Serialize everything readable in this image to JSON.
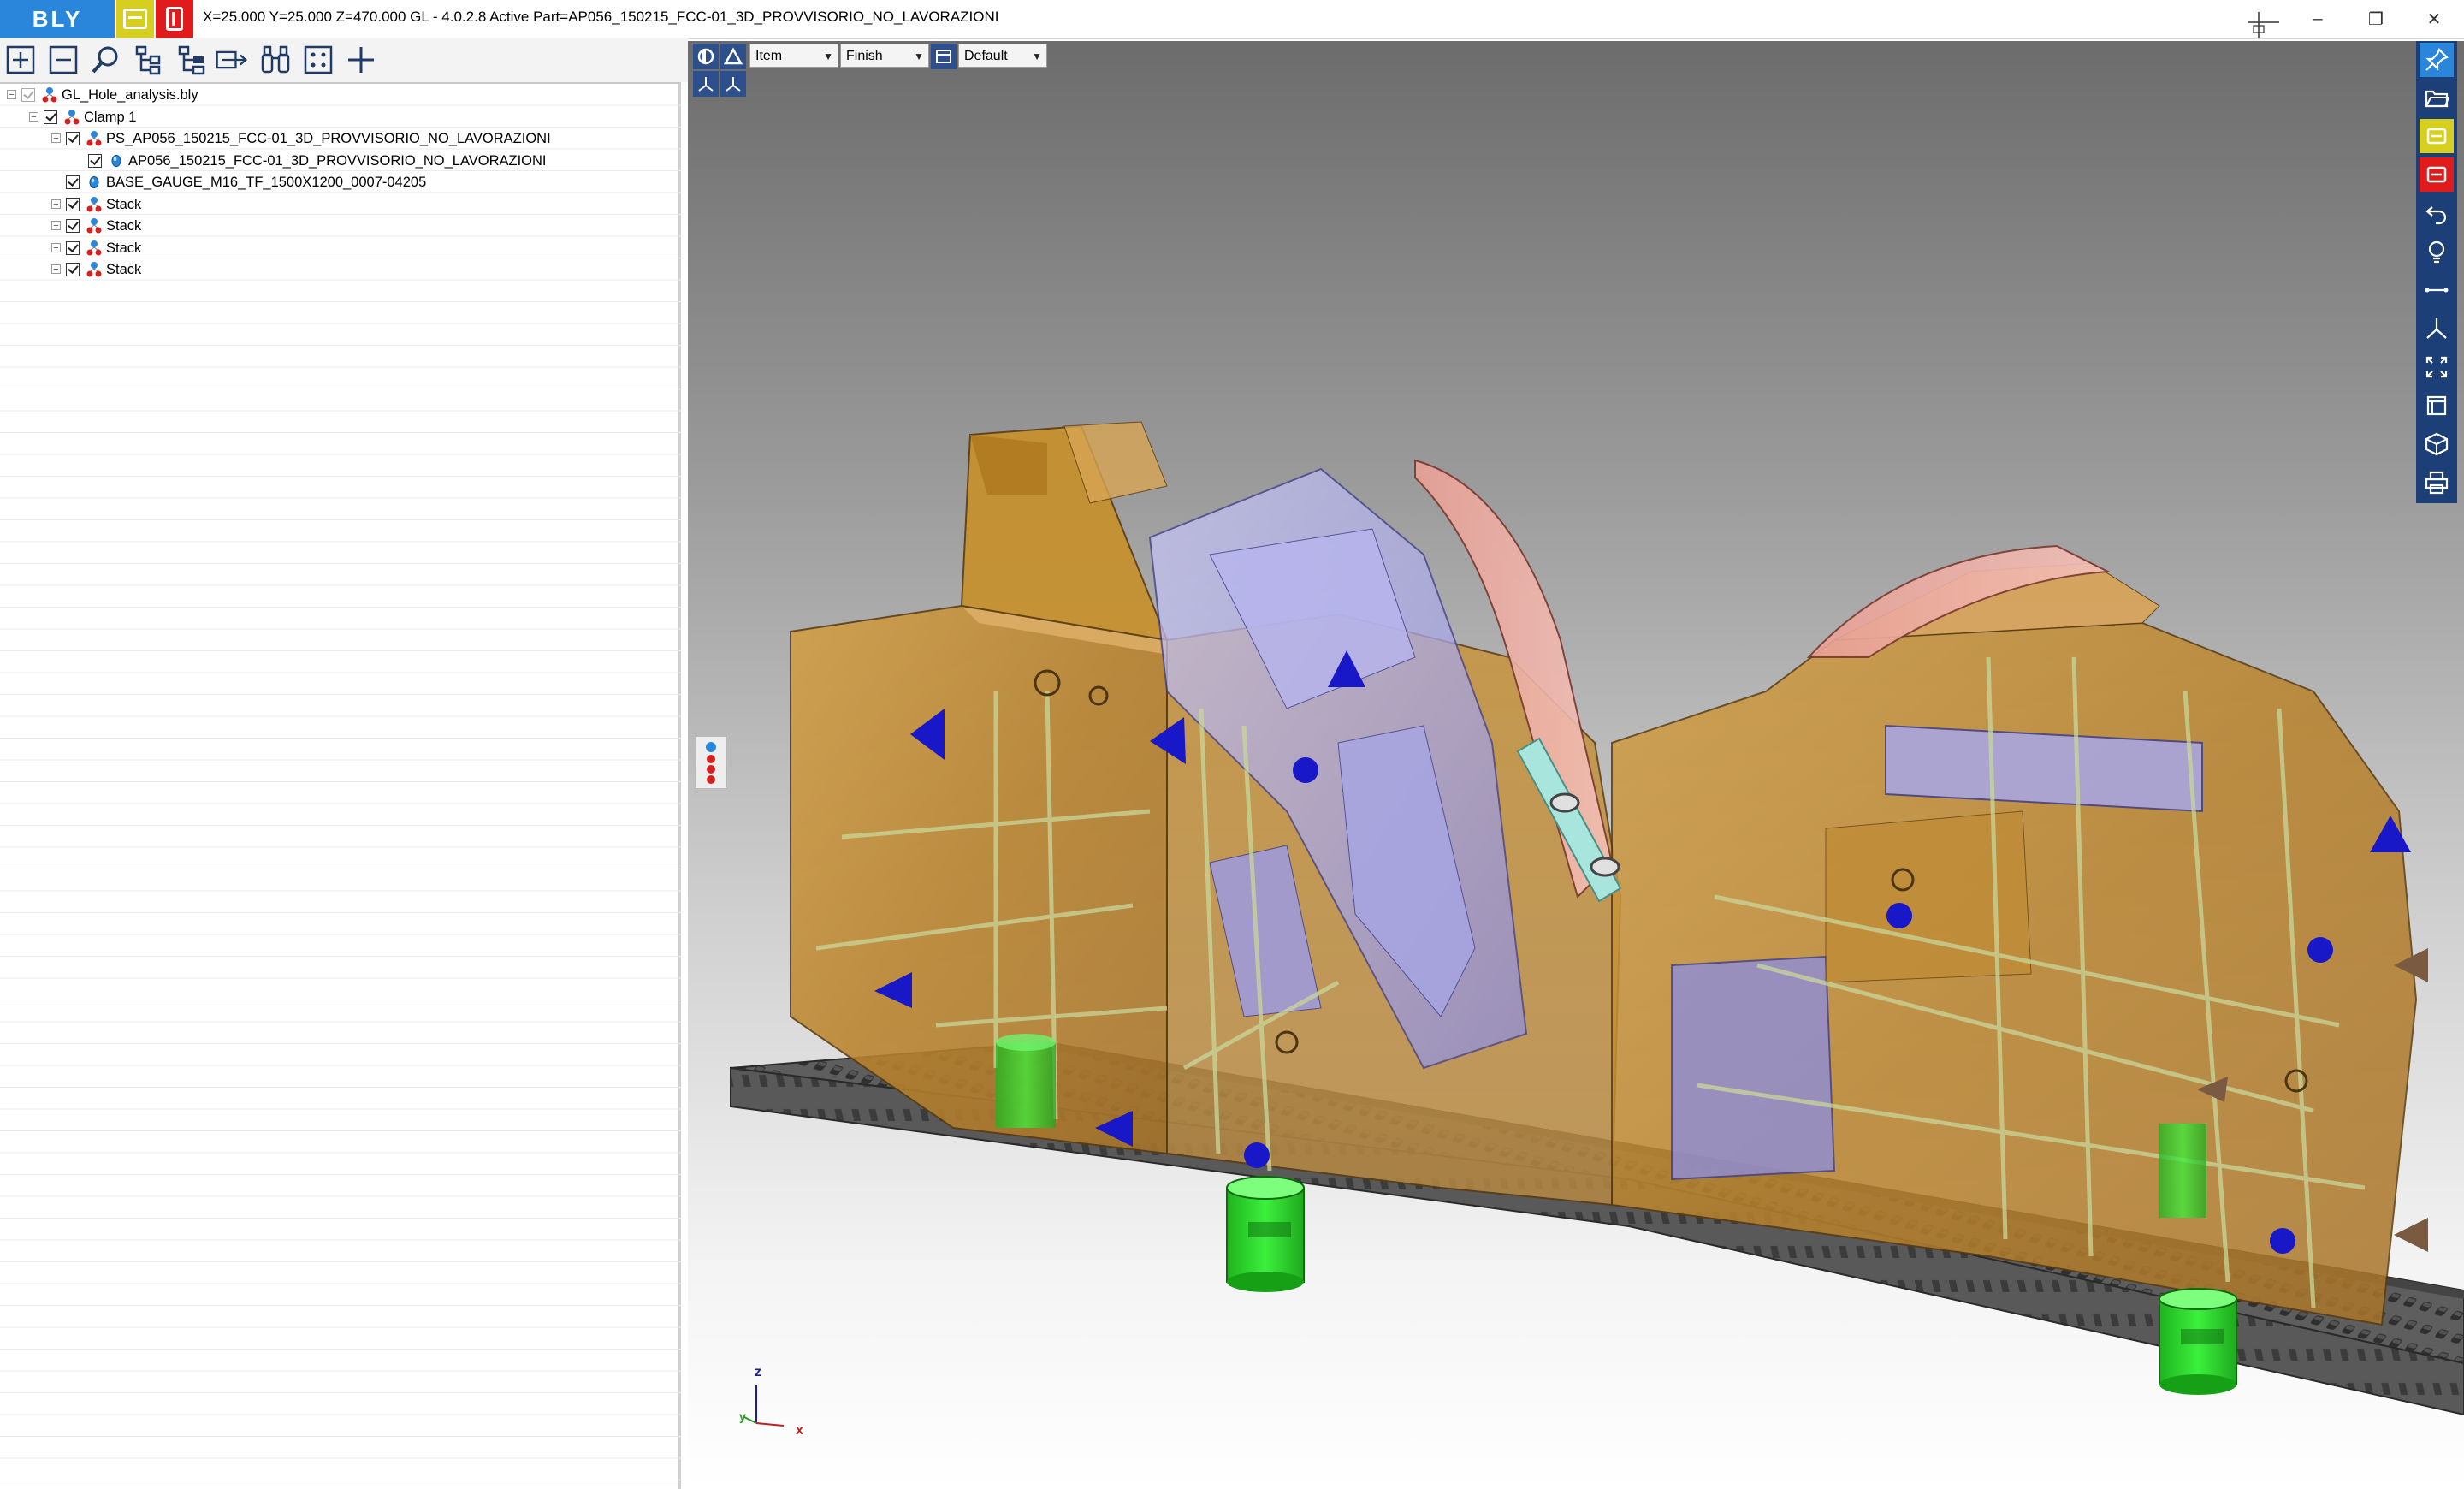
{
  "app": {
    "logo_text": "BLY",
    "title": "X=25.000 Y=25.000 Z=470.000   GL - 4.0.2.8 Active Part=AP056_150215_FCC-01_3D_PROVVISORIO_NO_LAVORAZIONI"
  },
  "window_controls": {
    "minimize": "–",
    "restore": "❐",
    "close": "✕"
  },
  "toolbar": {
    "icons": [
      "add-icon",
      "remove-icon",
      "search-icon",
      "tree-expand-icon",
      "tree-collapse-icon",
      "move-icon",
      "binoculars-icon",
      "frame-icon",
      "plus-cross-icon"
    ]
  },
  "tree": {
    "items": [
      {
        "label": "GL_Hole_analysis.bly",
        "level": 0,
        "expander": "⊟",
        "checked": "dim",
        "icon": "assembly"
      },
      {
        "label": "Clamp 1",
        "level": 1,
        "expander": "⊟",
        "checked": "yes",
        "icon": "assembly"
      },
      {
        "label": "PS_AP056_150215_FCC-01_3D_PROVVISORIO_NO_LAVORAZIONI",
        "level": 2,
        "expander": "⊟",
        "checked": "yes",
        "icon": "assembly"
      },
      {
        "label": "AP056_150215_FCC-01_3D_PROVVISORIO_NO_LAVORAZIONI",
        "level": 3,
        "expander": "",
        "checked": "yes",
        "icon": "part"
      },
      {
        "label": "BASE_GAUGE_M16_TF_1500X1200_0007-04205",
        "level": 2,
        "expander": "",
        "checked": "yes",
        "icon": "part"
      },
      {
        "label": "Stack",
        "level": 2,
        "expander": "⊞",
        "checked": "yes",
        "icon": "assembly"
      },
      {
        "label": "Stack",
        "level": 2,
        "expander": "⊞",
        "checked": "yes",
        "icon": "assembly"
      },
      {
        "label": "Stack",
        "level": 2,
        "expander": "⊞",
        "checked": "yes",
        "icon": "assembly"
      },
      {
        "label": "Stack",
        "level": 2,
        "expander": "⊞",
        "checked": "yes",
        "icon": "assembly"
      }
    ]
  },
  "viewport": {
    "selection_mode": "Item",
    "render_mode": "Finish",
    "view_preset": "Default",
    "axes": {
      "z": "z",
      "y": "y",
      "x": "x"
    }
  },
  "right_toolbar": {
    "icons": [
      "pin-icon",
      "open-folder-icon",
      "yellow-panel-icon",
      "red-panel-icon",
      "undo-icon",
      "lightbulb-icon",
      "measure-icon",
      "axes-icon",
      "fit-view-icon",
      "window-icon",
      "cube-view-icon",
      "print-icon"
    ]
  },
  "colors": {
    "accent": "#2a86db",
    "yellow": "#d7cf1f",
    "red": "#e11b1b",
    "toolbar_blue": "#1c3f77",
    "part_orange": "#c8902a",
    "support_green": "#29d82a",
    "plate": "#555555"
  }
}
